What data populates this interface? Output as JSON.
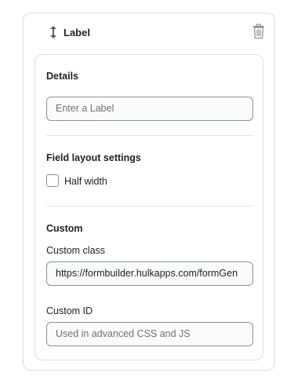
{
  "header": {
    "title": "Label",
    "drag_icon": "vertical-arrows-icon",
    "delete_icon": "trash-icon"
  },
  "details": {
    "title": "Details",
    "label_input": {
      "value": "",
      "placeholder": "Enter a Label"
    }
  },
  "layout": {
    "title": "Field layout settings",
    "half_width": {
      "label": "Half width",
      "checked": false
    }
  },
  "custom": {
    "title": "Custom",
    "class_label": "Custom class",
    "class_value": "https://formbuilder.hulkapps.com/formGen",
    "id_label": "Custom ID",
    "id_placeholder": "Used in advanced CSS and JS"
  },
  "colors": {
    "border": "#dcdcdc",
    "input_border": "#8c9196",
    "text": "#202223",
    "placeholder": "#6d7175"
  }
}
